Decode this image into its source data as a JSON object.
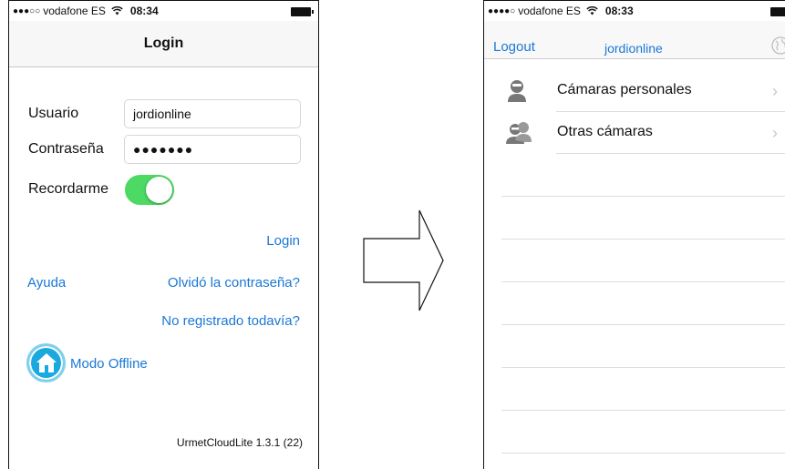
{
  "left_screen": {
    "status": {
      "signal": "●●●○○",
      "carrier": "vodafone ES",
      "wifi": "ᯤ",
      "time": "08:34"
    },
    "title": "Login",
    "username_label": "Usuario",
    "username_value": "jordionline",
    "password_label": "Contraseña",
    "password_value": "●●●●●●●",
    "remember_label": "Recordarme",
    "remember_on": true,
    "login_link": "Login",
    "help_link": "Ayuda",
    "forgot_link": "Olvidó la contraseña?",
    "register_link": "No registrado todavía?",
    "offline_label": "Modo Offline",
    "version": "UrmetCloudLite 1.3.1 (22)"
  },
  "right_screen": {
    "status": {
      "signal": "●●●●○",
      "carrier": "vodafone ES",
      "wifi": "ᯤ",
      "time": "08:33"
    },
    "logout": "Logout",
    "user": "jordionline",
    "items": [
      {
        "label": "Cámaras personales",
        "icon": "person-icon"
      },
      {
        "label": "Otras cámaras",
        "icon": "people-icon"
      }
    ]
  },
  "colors": {
    "link": "#1a78d6",
    "toggle_on": "#4cd964",
    "offline_icon": "#1aa9df"
  }
}
